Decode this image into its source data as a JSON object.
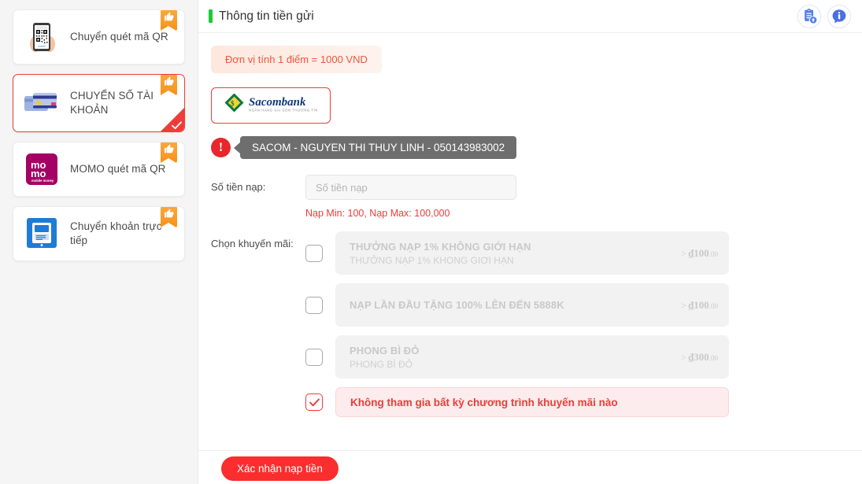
{
  "sidebar": {
    "methods": [
      {
        "id": "qr-transfer",
        "label": "Chuyển quét mã QR",
        "icon": "phone-qr-icon",
        "selected": false,
        "badge": "thumbs-up-ribbon"
      },
      {
        "id": "account-transfer",
        "label": "CHUYỂN SỐ TÀI KHOẢN",
        "icon": "credit-cards-icon",
        "selected": true,
        "badge": "thumbs-up-ribbon"
      },
      {
        "id": "momo-qr",
        "label": "MOMO quét mã QR",
        "icon": "momo-logo-icon",
        "selected": false,
        "badge": "thumbs-up-ribbon"
      },
      {
        "id": "direct-transfer",
        "label": "Chuyển khoản trực tiếp",
        "icon": "online-banking-icon",
        "selected": false,
        "badge": "thumbs-up-ribbon"
      }
    ]
  },
  "header": {
    "title": "Thông tin tiền gửi",
    "accent_color": "#17cc37",
    "actions": [
      {
        "id": "report-upload",
        "icon": "clipboard-upload-icon"
      },
      {
        "id": "info",
        "icon": "info-bubble-icon"
      }
    ]
  },
  "main": {
    "unit_note": "Đơn vị tính 1 điểm = 1000 VND",
    "bank": {
      "name": "Sacombank",
      "subtitle": "NGÂN HÀNG SÀI GÒN THƯƠNG TÍN",
      "selected": true
    },
    "account_tip": "SACOM - NGUYEN THI THUY LINH - 050143983002",
    "amount": {
      "label": "Số tiền nạp:",
      "placeholder": "Số tiền nạp",
      "value": "",
      "min_max": "Nạp Min:  100,  Nạp Max:  100,000"
    },
    "promo": {
      "label": "Chọn khuyến mãi:",
      "items": [
        {
          "id": "promo-1",
          "title": "THƯỞNG NẠP 1% KHÔNG GIỚI HẠN",
          "subtitle": "THƯỞNG NẠP 1% KHONG GIƠI HẠN",
          "price_prefix": ">",
          "price_currency": "₫",
          "price_main": "100",
          "price_cents": "00",
          "checked": false
        },
        {
          "id": "promo-2",
          "title": "NẠP LẦN ĐẦU TẶNG 100% LÊN ĐẾN 5888K",
          "subtitle": "",
          "price_prefix": ">",
          "price_currency": "₫",
          "price_main": "100",
          "price_cents": "00",
          "checked": false
        },
        {
          "id": "promo-3",
          "title": "PHONG BÌ ĐỎ",
          "subtitle": "PHONG BÌ ĐỎ",
          "price_prefix": ">",
          "price_currency": "₫",
          "price_main": "300",
          "price_cents": "00",
          "checked": false
        }
      ],
      "none_option": {
        "id": "promo-none",
        "label": "Không tham gia bất kỳ chương trình khuyến mãi nào",
        "checked": true
      }
    },
    "confirm_label": "Xác nhận nạp tiền"
  },
  "colors": {
    "brand_red": "#f03b3b",
    "button_red": "#fa2e2e",
    "accent_green": "#17cc37",
    "icon_blue": "#5680e9",
    "ribbon_orange": "#f7941e"
  }
}
